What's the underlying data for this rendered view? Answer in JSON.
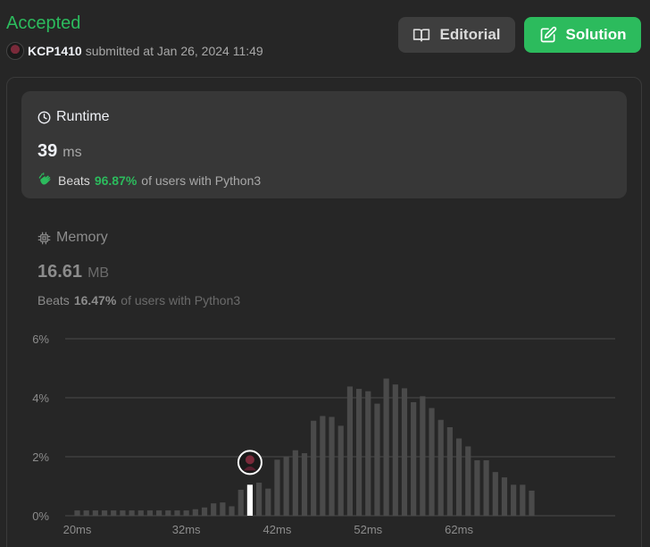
{
  "header": {
    "status": "Accepted",
    "username": "KCP1410",
    "submitted_text": "submitted at Jan 26, 2024 11:49",
    "editorial_label": "Editorial",
    "solution_label": "Solution"
  },
  "runtime": {
    "title": "Runtime",
    "value": "39",
    "unit": "ms",
    "beats_label": "Beats",
    "beats_pct": "96.87%",
    "beats_rest": "of users with Python3"
  },
  "memory": {
    "title": "Memory",
    "value": "16.61",
    "unit": "MB",
    "beats_label": "Beats",
    "beats_pct": "16.47%",
    "beats_rest": "of users with Python3"
  },
  "colors": {
    "accent": "#2cbb5d",
    "bar": "#4a4a4a",
    "highlight_bar": "#ffffff"
  },
  "chart_data": {
    "type": "bar",
    "y_ticks": [
      "6%",
      "4%",
      "2%",
      "0%"
    ],
    "ylim": [
      0,
      6
    ],
    "x_tick_labels": [
      "20ms",
      "32ms",
      "42ms",
      "52ms",
      "62ms"
    ],
    "x_tick_values": [
      20,
      32,
      42,
      52,
      62
    ],
    "x": [
      20,
      21,
      22,
      23,
      24,
      25,
      26,
      27,
      28,
      29,
      30,
      31,
      32,
      33,
      34,
      35,
      36,
      37,
      38,
      39,
      40,
      41,
      42,
      43,
      44,
      45,
      46,
      47,
      48,
      49,
      50,
      51,
      52,
      53,
      54,
      55,
      56,
      57,
      58,
      59,
      60,
      61,
      62,
      63,
      64,
      65,
      66,
      67,
      68,
      69,
      70
    ],
    "values": [
      0.18,
      0.18,
      0.18,
      0.18,
      0.18,
      0.18,
      0.18,
      0.18,
      0.18,
      0.18,
      0.18,
      0.18,
      0.18,
      0.22,
      0.28,
      0.42,
      0.45,
      0.32,
      0.88,
      1.05,
      1.12,
      0.92,
      1.9,
      2.0,
      2.22,
      2.12,
      3.22,
      3.38,
      3.35,
      3.05,
      4.38,
      4.3,
      4.22,
      3.8,
      4.65,
      4.45,
      4.32,
      3.85,
      4.05,
      3.65,
      3.25,
      3.0,
      2.62,
      2.35,
      1.88,
      1.88,
      1.48,
      1.3,
      1.05,
      1.05,
      0.85
    ],
    "highlight_x": 39
  }
}
